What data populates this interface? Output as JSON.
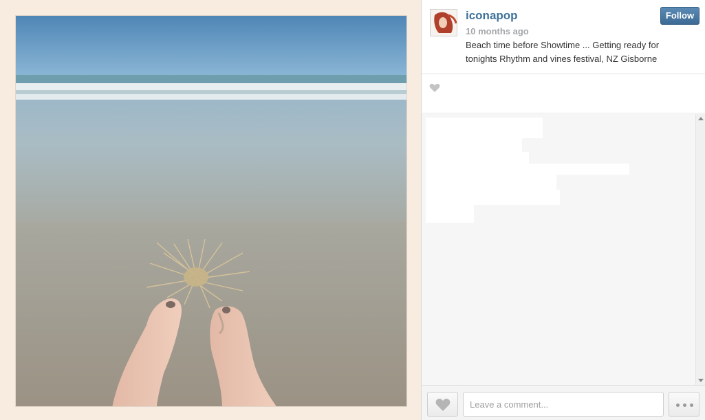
{
  "post": {
    "username": "iconapop",
    "time_ago": "10 months ago",
    "caption": "Beach time before Showtime ... Getting ready for tonights Rhythm and vines festival, NZ Gisborne",
    "follow_label": "Follow"
  },
  "comment_box": {
    "placeholder": "Leave a comment..."
  },
  "icons": {
    "like": "heart-icon",
    "more": "ellipsis-icon",
    "likes_heart": "heart-icon"
  },
  "colors": {
    "username": "#3f729b",
    "follow_button": "#4a7aa5",
    "panel_background": "#f8ece1"
  }
}
